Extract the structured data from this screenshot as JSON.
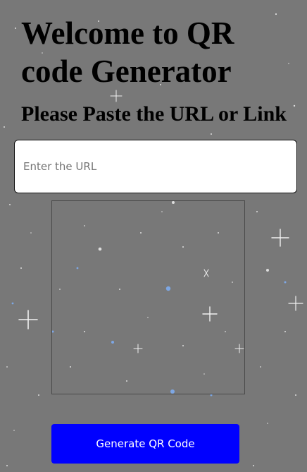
{
  "header": {
    "title": "Welcome to QR code Generator",
    "subtitle": "Please Paste the URL or Link"
  },
  "form": {
    "url_placeholder": "Enter the URL",
    "url_value": "",
    "generate_label": "Generate QR Code"
  },
  "colors": {
    "background": "#787878",
    "button": "#0000ff",
    "button_text": "#ffffff"
  }
}
